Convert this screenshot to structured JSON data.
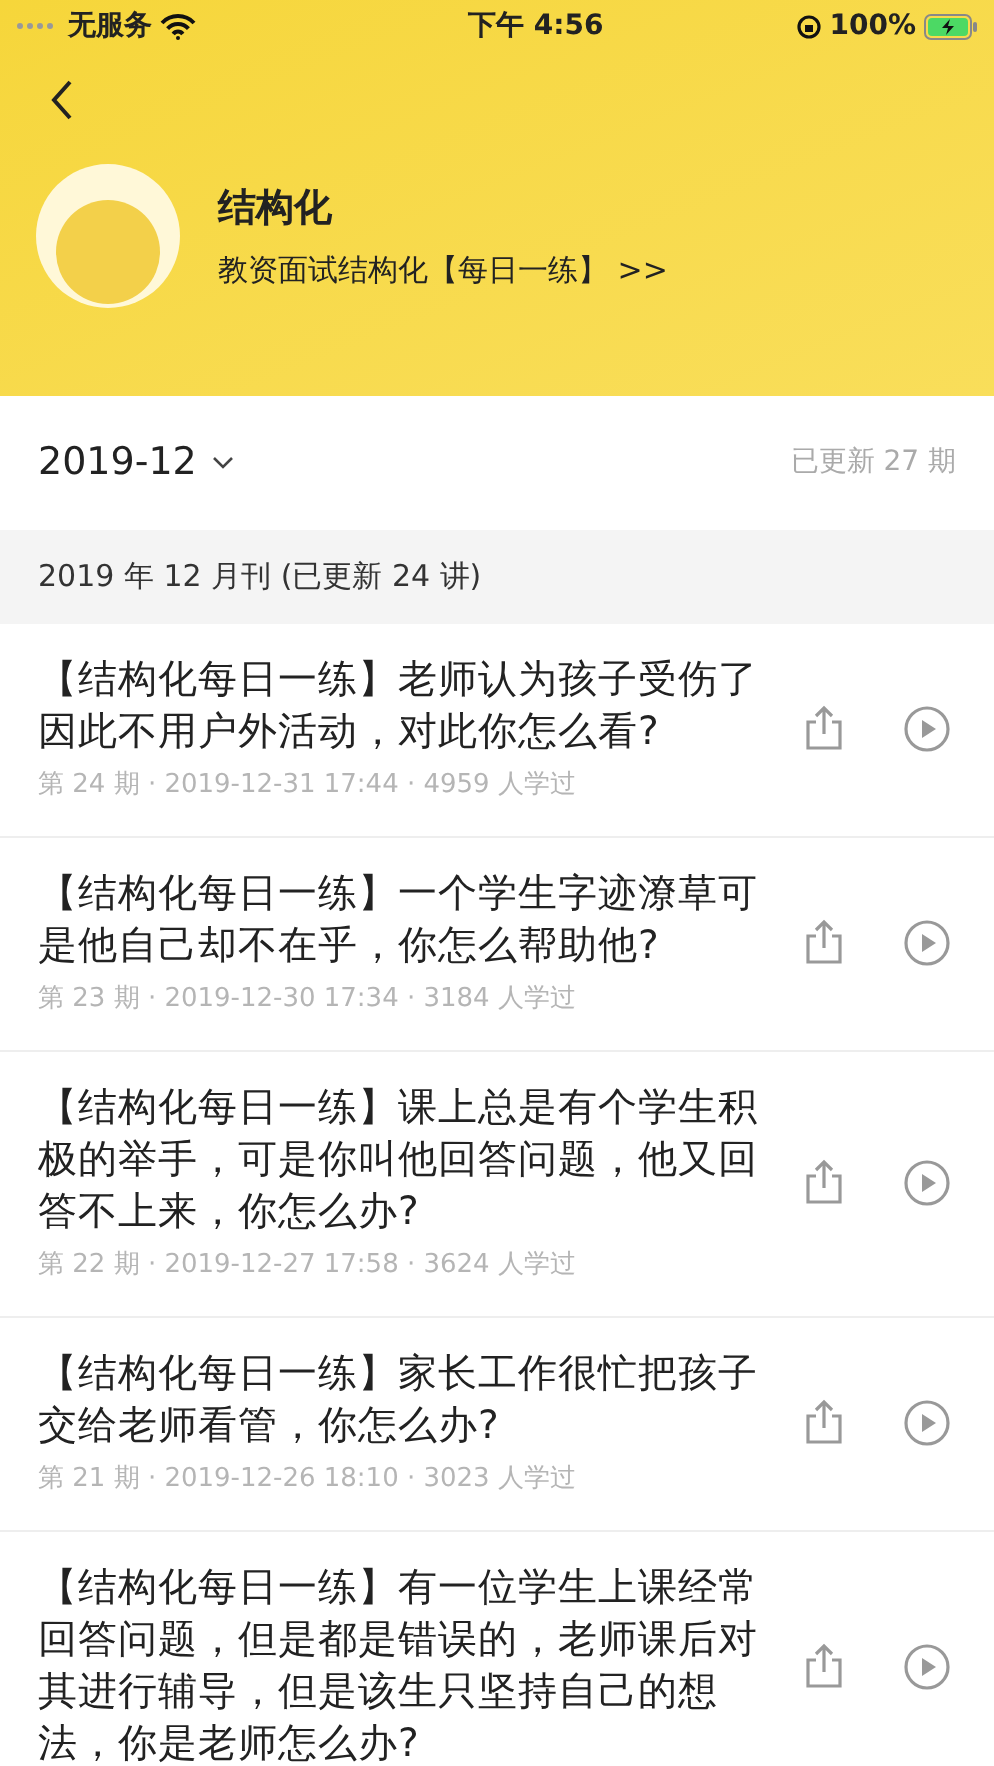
{
  "status_bar": {
    "carrier": "无服务",
    "time": "下午 4:56",
    "battery": "100%"
  },
  "header": {
    "title": "结构化",
    "subtitle": "教资面试结构化【每日一练】 >>"
  },
  "month_picker": {
    "label": "2019-12",
    "update_count": "已更新 27 期"
  },
  "section_header": "2019 年 12 月刊 (已更新 24 讲)",
  "episodes": [
    {
      "title": "【结构化每日一练】老师认为孩子受伤了因此不用户外活动，对此你怎么看?",
      "meta": "第 24 期 · 2019-12-31 17:44 · 4959 人学过"
    },
    {
      "title": "【结构化每日一练】一个学生字迹潦草可是他自己却不在乎，你怎么帮助他?",
      "meta": "第 23 期 · 2019-12-30 17:34 · 3184 人学过"
    },
    {
      "title": "【结构化每日一练】课上总是有个学生积极的举手，可是你叫他回答问题，他又回答不上来，你怎么办?",
      "meta": "第 22 期 · 2019-12-27 17:58 · 3624 人学过"
    },
    {
      "title": "【结构化每日一练】家长工作很忙把孩子交给老师看管，你怎么办?",
      "meta": "第 21 期 · 2019-12-26 18:10 · 3023 人学过"
    },
    {
      "title": "【结构化每日一练】有一位学生上课经常回答问题，但是都是错误的，老师课后对其进行辅导，但是该生只坚持自己的想法，你是老师怎么办?"
    }
  ]
}
